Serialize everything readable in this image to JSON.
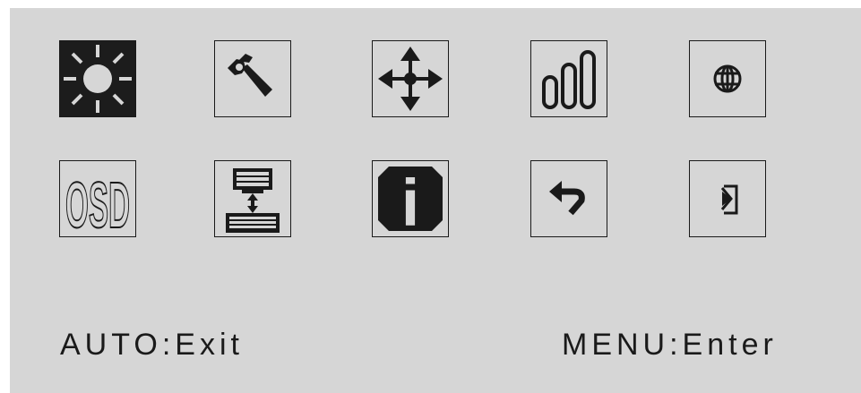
{
  "menu": {
    "items": [
      {
        "name": "brightness",
        "icon": "sun-icon",
        "selected": true
      },
      {
        "name": "settings",
        "icon": "wrench-icon",
        "selected": false
      },
      {
        "name": "position",
        "icon": "move-arrows-icon",
        "selected": false
      },
      {
        "name": "color",
        "icon": "color-bars-icon",
        "selected": false
      },
      {
        "name": "language",
        "icon": "globe-icon",
        "selected": false
      },
      {
        "name": "osd",
        "icon": "osd-text-icon",
        "osd_label": "OSD",
        "selected": false
      },
      {
        "name": "input-source",
        "icon": "input-switch-icon",
        "selected": false
      },
      {
        "name": "information",
        "icon": "info-icon",
        "info_glyph": "i",
        "selected": false
      },
      {
        "name": "reset",
        "icon": "reset-arrow-icon",
        "selected": false
      },
      {
        "name": "exit",
        "icon": "exit-door-icon",
        "selected": false
      }
    ]
  },
  "footer": {
    "auto_hint": "AUTO:Exit",
    "menu_hint": "MENU:Enter"
  },
  "colors": {
    "panel": "#d6d6d6",
    "ink": "#1a1a1a",
    "selected": "#1c1c1c"
  }
}
